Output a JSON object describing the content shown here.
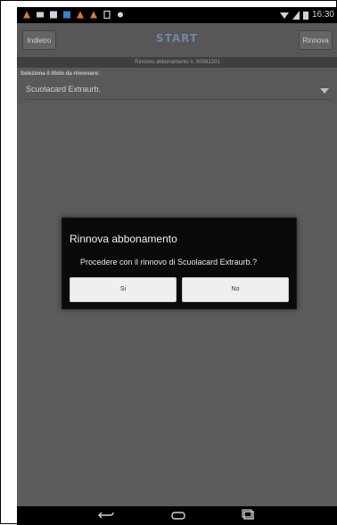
{
  "status_bar": {
    "time": "16:30",
    "left_icons": [
      "warning-icon",
      "message-icon",
      "image-icon",
      "app-icon",
      "warning-icon",
      "warning-icon",
      "tablet-icon",
      "camera-icon"
    ],
    "right_icons": [
      "wifi-icon",
      "signal-icon",
      "battery-icon"
    ]
  },
  "app_bar": {
    "back_label": "Indietro",
    "logo_text": "START",
    "renew_label": "Rinnova"
  },
  "subheader": {
    "text": "Rinnovo abbonamento n. 80081201"
  },
  "form": {
    "label": "Seleziona il titolo da rinnovare:",
    "selected_value": "Scuolacard Extraurb."
  },
  "dialog": {
    "title": "Rinnova abbonamento",
    "message": "Procedere con il rinnovo di Scuolacard Extraurb.?",
    "yes_label": "Si",
    "no_label": "No"
  },
  "nav_bar": {
    "icons": [
      "back-icon",
      "home-icon",
      "recent-apps-icon"
    ]
  }
}
